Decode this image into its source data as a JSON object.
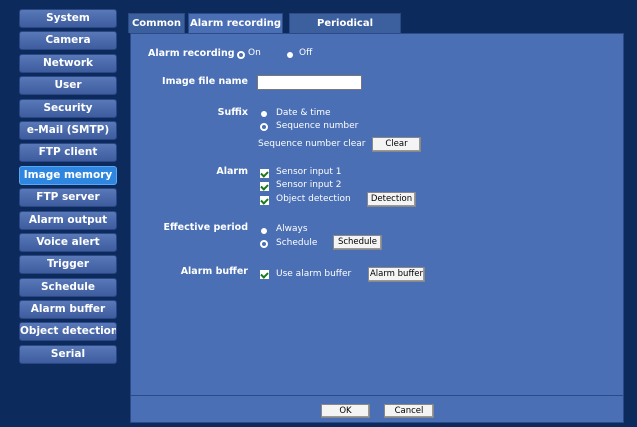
{
  "sidebar": {
    "items": [
      {
        "label": "System"
      },
      {
        "label": "Camera"
      },
      {
        "label": "Network"
      },
      {
        "label": "User"
      },
      {
        "label": "Security"
      },
      {
        "label": "e-Mail (SMTP)"
      },
      {
        "label": "FTP client"
      },
      {
        "label": "Image memory"
      },
      {
        "label": "FTP server"
      },
      {
        "label": "Alarm output"
      },
      {
        "label": "Voice alert"
      },
      {
        "label": "Trigger"
      },
      {
        "label": "Schedule"
      },
      {
        "label": "Alarm buffer"
      },
      {
        "label": "Object detection"
      },
      {
        "label": "Serial"
      }
    ],
    "active_item": "Image memory"
  },
  "tabs": [
    {
      "label": "Common"
    },
    {
      "label": "Alarm recording"
    },
    {
      "label": "Periodical recording"
    }
  ],
  "active_tab": "Alarm recording",
  "form": {
    "alarm_recording": {
      "label": "Alarm recording",
      "on": "On",
      "off": "Off",
      "selected": "On"
    },
    "image_file_name": {
      "label": "Image file name",
      "value": ""
    },
    "suffix": {
      "label": "Suffix",
      "opt_date": "Date & time",
      "opt_seq": "Sequence number",
      "selected": "Sequence number",
      "seq_clear_label": "Sequence number clear",
      "clear_button": "Clear"
    },
    "alarm": {
      "label": "Alarm",
      "sensor1": "Sensor input 1",
      "sensor2": "Sensor input 2",
      "object": "Object detection",
      "detection_button": "Detection",
      "sensor1_checked": true,
      "sensor2_checked": true,
      "object_checked": true
    },
    "effective_period": {
      "label": "Effective period",
      "opt_always": "Always",
      "opt_schedule": "Schedule",
      "selected": "Schedule",
      "schedule_button": "Schedule"
    },
    "alarm_buffer": {
      "label": "Alarm buffer",
      "use": "Use alarm buffer",
      "use_checked": true,
      "button": "Alarm buffer"
    }
  },
  "footer": {
    "ok": "OK",
    "cancel": "Cancel"
  },
  "colors": {
    "background": "#0d2a5c",
    "panel": "#4a6fb4",
    "sidebar_button": "#4a6ab0",
    "active_button": "#2f86e0"
  }
}
